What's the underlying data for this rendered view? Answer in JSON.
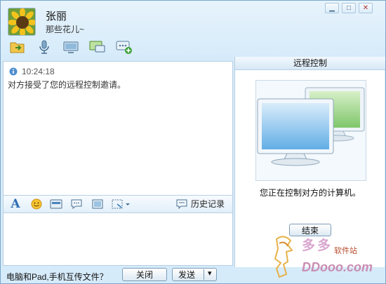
{
  "contact": {
    "name": "张丽",
    "status": "那些花儿~"
  },
  "window_controls": [
    "▁",
    "□",
    "✕"
  ],
  "toolbar": [
    {
      "name": "file-transfer-icon"
    },
    {
      "name": "voice-call-icon"
    },
    {
      "name": "video-call-icon"
    },
    {
      "name": "remote-control-icon"
    },
    {
      "name": "app-more-icon"
    }
  ],
  "chat": {
    "message_time": "10:24:18",
    "message_text": "对方接受了您的远程控制邀请。"
  },
  "format_bar": {
    "history_label": "历史记录"
  },
  "bottom": {
    "transfer_hint": "电脑和Pad,手机互传文件？",
    "close_label": "关闭",
    "send_label": "发送",
    "send_dropdown": "▾"
  },
  "remote_panel": {
    "title": "远程控制",
    "description": "您正在控制对方的计算机。",
    "end_label": "结束"
  },
  "watermark": {
    "title": "多多",
    "subtitle": "软件站",
    "domain": "DDooo.com"
  },
  "colors": {
    "accent": "#3a7bbf",
    "window_bg": "#d6ebfa",
    "border": "#b7cfe3"
  }
}
